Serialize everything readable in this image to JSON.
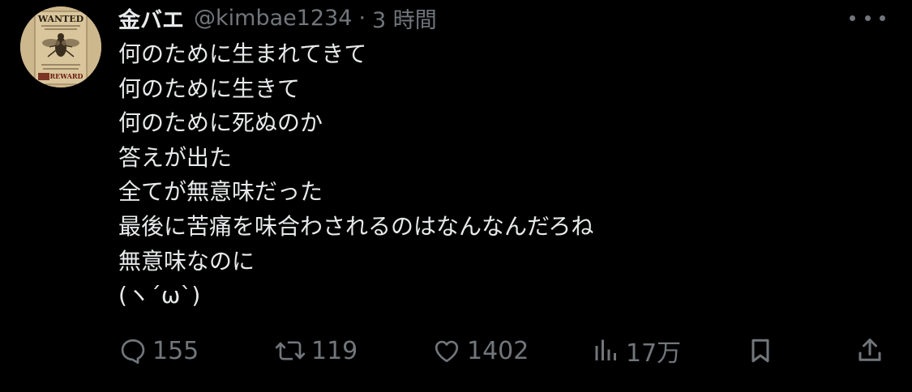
{
  "tweet": {
    "author": {
      "display_name": "金バエ",
      "handle": "@kimbae1234",
      "separator": "·",
      "time": "3 時間",
      "avatar_text": {
        "title": "WANTED",
        "reward": "REWARD"
      }
    },
    "lines": [
      "何のために生まれてきて",
      "何のために生きて",
      "何のために死ぬのか",
      "答えが出た",
      "全てが無意味だった",
      "最後に苦痛を味合わされるのはなんなんだろね",
      "無意味なのに",
      "(ヽ´ω`)"
    ],
    "actions": {
      "replies": "155",
      "retweets": "119",
      "likes": "1402",
      "views": "17万"
    },
    "colors": {
      "background": "#000000",
      "text": "#e7e9ea",
      "muted": "#71767b"
    },
    "icons": [
      "more-icon",
      "reply-icon",
      "retweet-icon",
      "like-icon",
      "views-icon",
      "bookmark-icon",
      "share-icon"
    ]
  }
}
